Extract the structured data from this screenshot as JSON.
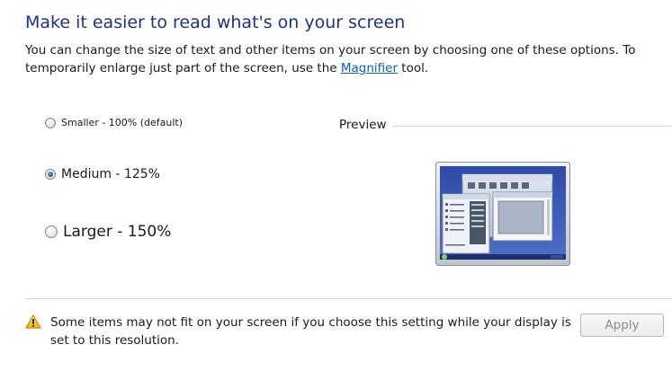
{
  "header": {
    "title": "Make it easier to read what's on your screen",
    "desc_before_link": "You can change the size of text and other items on your screen by choosing one of these options. To temporarily enlarge just part of the screen, use the ",
    "link_text": "Magnifier",
    "desc_after_link": " tool."
  },
  "options": [
    {
      "label": "Smaller - 100% (default)",
      "selected": false
    },
    {
      "label": "Medium - 125%",
      "selected": true
    },
    {
      "label": "Larger - 150%",
      "selected": false
    }
  ],
  "preview": {
    "label": "Preview"
  },
  "warning": {
    "icon": "warning-icon",
    "text": "Some items may not fit on your screen if you choose this setting while your display is set to this resolution."
  },
  "footer": {
    "apply_label": "Apply",
    "apply_enabled": false
  },
  "colors": {
    "title": "#1e3287",
    "link": "#0b5fb8",
    "radio_selected": "#1c5ca3"
  }
}
